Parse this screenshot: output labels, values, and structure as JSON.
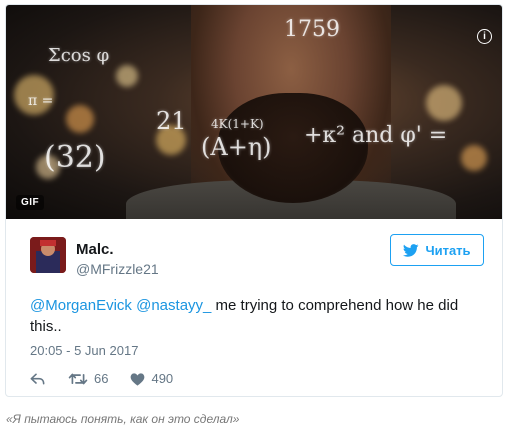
{
  "media": {
    "gif_label": "GIF",
    "info_icon": "i",
    "equations": [
      "1759",
      "Σcos φ",
      "21",
      "4K(1+K)",
      "(A+η)",
      "+κ² and φ' =",
      "(32)",
      "π ="
    ]
  },
  "tweet": {
    "display_name": "Malc.",
    "handle": "@MFrizzle21",
    "follow_label": "Читать",
    "mention_1": "@MorganEvick",
    "mention_2": "@nastayy_",
    "text": " me trying to comprehend how he did this..",
    "timestamp": "20:05 - 5 Jun 2017",
    "retweets": "66",
    "likes": "490"
  },
  "caption": "«Я пытаюсь понять, как он это сделал»",
  "colors": {
    "accent": "#1da1f2",
    "mention": "#1b95e0",
    "muted": "#657786"
  }
}
